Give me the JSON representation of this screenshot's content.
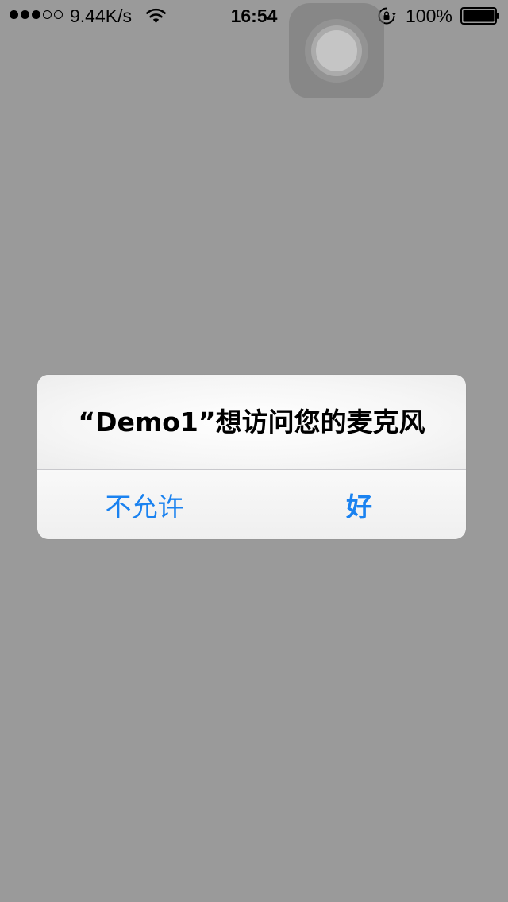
{
  "status_bar": {
    "signal_filled": 3,
    "signal_total": 5,
    "net_speed": "9.44K/s",
    "time": "16:54",
    "battery_percent": "100%",
    "battery_level": 1.0,
    "icons": [
      "signal-dots-icon",
      "wifi-icon",
      "rotation-lock-icon",
      "battery-icon"
    ]
  },
  "assistive_touch": {
    "icon": "assistive-touch-icon"
  },
  "alert": {
    "title": "“Demo1”想访问您的麦克风",
    "deny_label": "不允许",
    "allow_label": "好"
  },
  "colors": {
    "overlay_background": "#9a9a9a",
    "accent": "#1a82f0"
  }
}
